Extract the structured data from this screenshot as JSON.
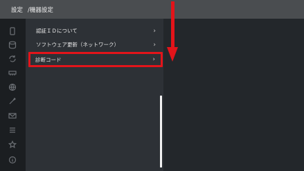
{
  "header": {
    "title": "設定",
    "breadcrumb": "/機器設定"
  },
  "rail": {
    "icons": [
      "device-icon",
      "storage-icon",
      "refresh-icon",
      "network-icon",
      "globe-icon",
      "tools-icon",
      "mail-icon",
      "list-icon",
      "star-icon",
      "info-icon"
    ]
  },
  "menu": {
    "items": [
      {
        "label": "認証ＩＤについて",
        "chevron": "›"
      },
      {
        "label": "ソフトウェア更新（ネットワーク）",
        "chevron": "›"
      },
      {
        "label": "診断コード",
        "chevron": "›"
      }
    ]
  },
  "annotation": {
    "highlight_color": "#e3141a",
    "arrow_color": "#e3141a"
  }
}
